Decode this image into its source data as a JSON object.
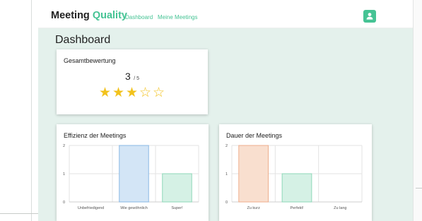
{
  "navbar": {
    "brand_main": "Meeting",
    "brand_accent": "Quality",
    "links": [
      "Dashboard",
      "Meine Meetings"
    ],
    "accent_color": "#45c394"
  },
  "page": {
    "title": "Dashboard"
  },
  "rating_card": {
    "title": "Gesamtbewertung",
    "score": "3",
    "max": "/ 5",
    "stars_filled": 3,
    "stars_total": 5
  },
  "charts": [
    {
      "title": "Effizienz der Meetings"
    },
    {
      "title": "Dauer der Meetings"
    }
  ],
  "chart_data": [
    {
      "type": "bar",
      "title": "Effizienz der Meetings",
      "categories": [
        "Unbefriedigend",
        "Wie gewöhnlich",
        "Super!"
      ],
      "values": [
        0,
        2,
        1
      ],
      "ylim": [
        0,
        2
      ],
      "yticks": [
        "0",
        "1",
        "2"
      ],
      "grid": true,
      "bar_colors": [
        {
          "fill": "#f9d9c8",
          "stroke": "#eeae8c"
        },
        {
          "fill": "#d3e5f6",
          "stroke": "#89b8e4"
        },
        {
          "fill": "#d5f1e5",
          "stroke": "#8ed8b8"
        }
      ]
    },
    {
      "type": "bar",
      "title": "Dauer der Meetings",
      "categories": [
        "Zu kurz",
        "Perfekt!",
        "Zu lang"
      ],
      "values": [
        2,
        1,
        0
      ],
      "ylim": [
        0,
        2
      ],
      "yticks": [
        "0",
        "1",
        "2"
      ],
      "grid": true,
      "bar_colors": [
        {
          "fill": "#f9dfcf",
          "stroke": "#eeae8c"
        },
        {
          "fill": "#d5f1e5",
          "stroke": "#8ed8b8"
        },
        {
          "fill": "#d3e5f6",
          "stroke": "#89b8e4"
        }
      ]
    }
  ]
}
